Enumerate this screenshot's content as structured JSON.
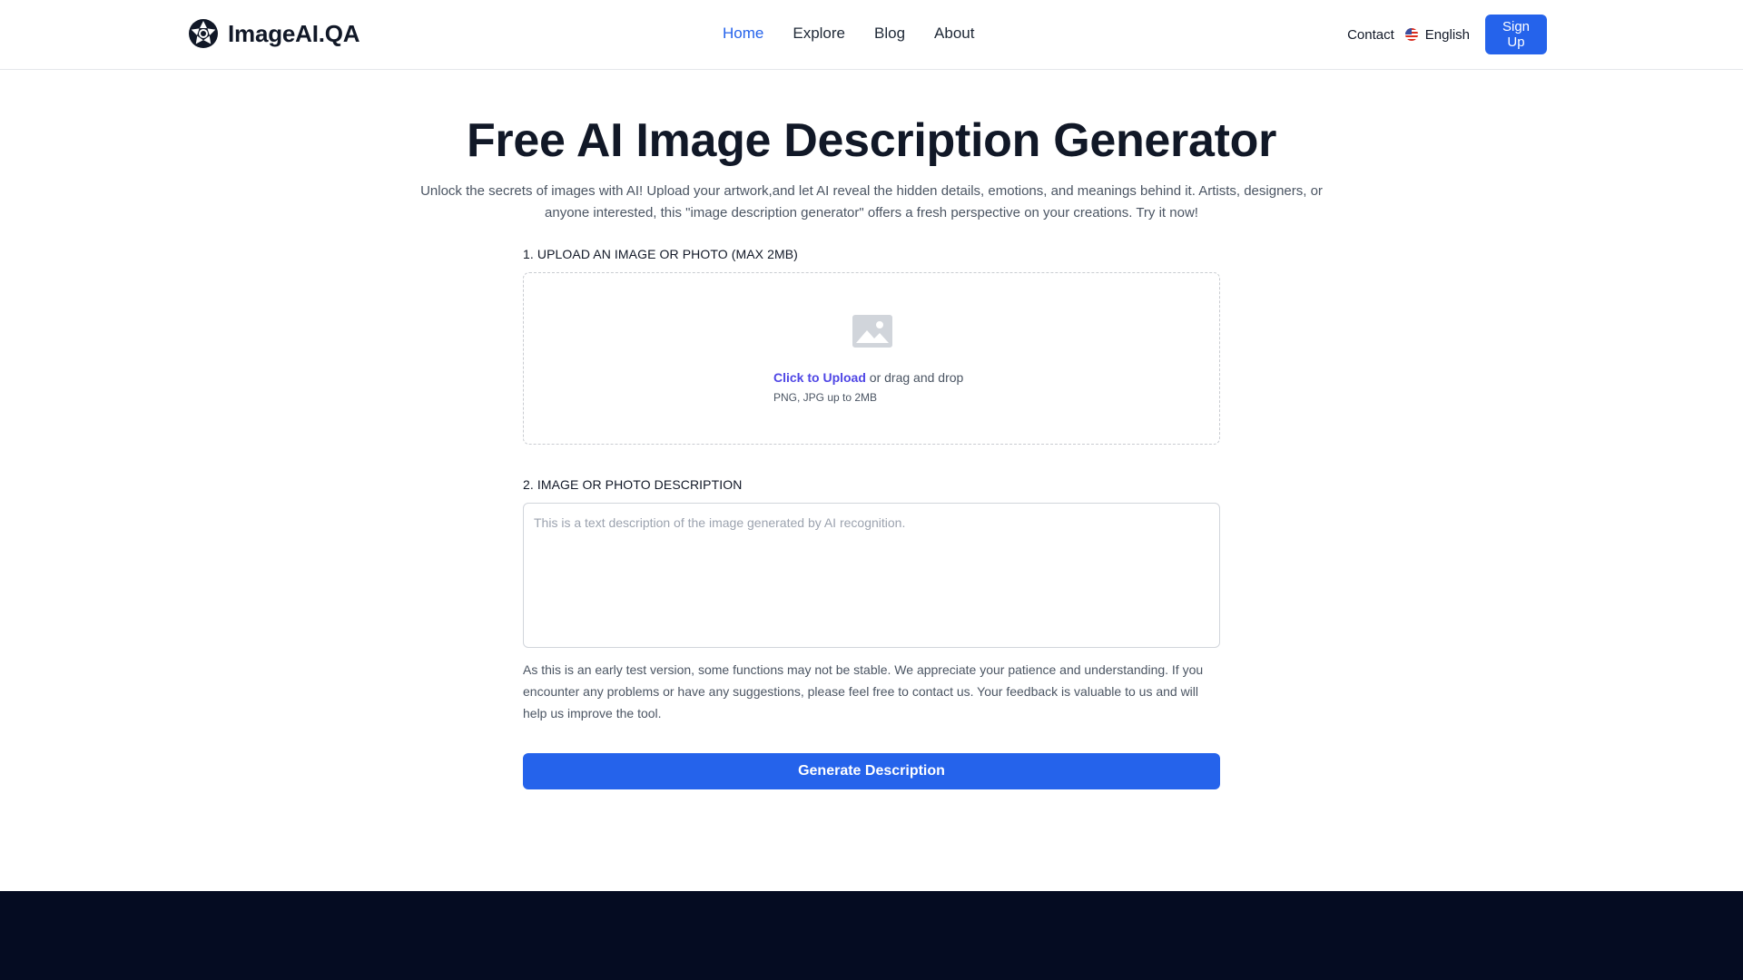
{
  "brand": {
    "name": "ImageAI.QA",
    "logo_icon": "aperture-icon"
  },
  "nav": {
    "items": [
      {
        "label": "Home",
        "active": true
      },
      {
        "label": "Explore",
        "active": false
      },
      {
        "label": "Blog",
        "active": false
      },
      {
        "label": "About",
        "active": false
      }
    ]
  },
  "header_right": {
    "contact_label": "Contact",
    "language_label": "English",
    "language_flag": "us-flag-icon",
    "signup_label": "Sign Up"
  },
  "main": {
    "title": "Free AI Image Description Generator",
    "intro": "Unlock the secrets of images with AI! Upload your artwork,and let AI reveal the hidden details, emotions, and meanings behind it. Artists, designers, or anyone interested, this \"image description generator\" offers a fresh perspective on your creations. Try it now!",
    "upload_section": {
      "label": "1. UPLOAD AN IMAGE OR PHOTO (MAX 2MB)",
      "icon": "image-icon",
      "click_text": "Click to Upload",
      "drag_text": " or drag and drop",
      "hint": "PNG, JPG up to 2MB"
    },
    "description_section": {
      "label": "2. IMAGE OR PHOTO DESCRIPTION",
      "placeholder": "This is a text description of the image generated by AI recognition.",
      "value": ""
    },
    "notice": "As this is an early test version, some functions may not be stable. We appreciate your patience and understanding. If you encounter any problems or have any suggestions, please feel free to contact us. Your feedback is valuable to us and will help us improve the tool.",
    "generate_label": "Generate Description"
  },
  "colors": {
    "primary": "#2563eb",
    "link_accent": "#4f46e5",
    "heading": "#111827",
    "body_text": "#4b5563",
    "footer_bg": "#050c22"
  }
}
